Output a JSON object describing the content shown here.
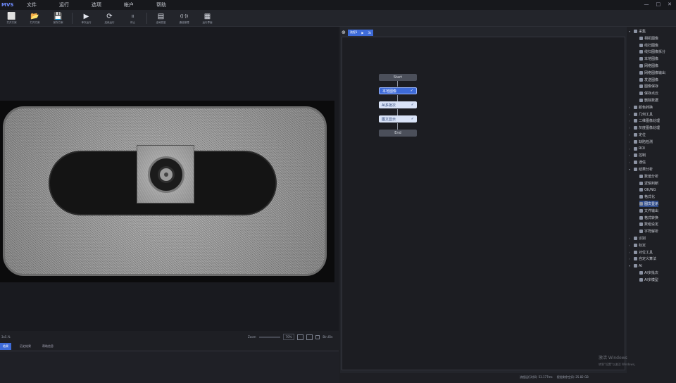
{
  "app": {
    "brand": "MVS"
  },
  "menu": [
    "文件",
    "运行",
    "选项",
    "帐户",
    "帮助"
  ],
  "window_controls": [
    "—",
    "□",
    "✕"
  ],
  "toolbar": [
    {
      "icon": "⬜",
      "label": "打开方案",
      "disabled": false
    },
    {
      "icon": "📂",
      "label": "打开方案",
      "disabled": false
    },
    {
      "icon": "💾",
      "label": "保存方案",
      "disabled": false
    },
    {
      "icon": "▶",
      "label": "单次运行",
      "disabled": false
    },
    {
      "icon": "⟳",
      "label": "连续运行",
      "disabled": false
    },
    {
      "icon": "⏸",
      "label": "停止",
      "disabled": true
    },
    {
      "icon": "▤",
      "label": "全局变量",
      "disabled": false
    },
    {
      "icon": "((·))",
      "label": "通信管理",
      "disabled": false
    },
    {
      "icon": "▦",
      "label": "运行界面",
      "disabled": false
    }
  ],
  "image_status": {
    "left": "3x5.%",
    "zoom_label": "Zoom",
    "zoom_value": "70%",
    "extra": "Bin.Bin"
  },
  "bottom_tabs": [
    {
      "label": "结果",
      "active": true
    },
    {
      "label": "历史结果",
      "active": false
    },
    {
      "label": "帮助信息",
      "active": false
    }
  ],
  "flow": {
    "tab_label": "流程1",
    "tab_play": "▶",
    "tab_count": "3s",
    "nodes": [
      {
        "label": "Start",
        "kind": "start"
      },
      {
        "label": "本地图像",
        "kind": "tool",
        "selected": true,
        "check": "✓"
      },
      {
        "label": "AI多批次",
        "kind": "tool",
        "selected": false,
        "check": "✓"
      },
      {
        "label": "图文显示",
        "kind": "tool",
        "selected": false,
        "check": "✓"
      },
      {
        "label": "End",
        "kind": "end"
      }
    ],
    "status_time": "流程运行时间: 53.177ms",
    "status_mem": "视觉剩余空间: 25.82 GB"
  },
  "tree": [
    {
      "label": "采集",
      "level": 0,
      "caret": "▾"
    },
    {
      "label": "相机图像",
      "level": 1
    },
    {
      "label": "线扫图像",
      "level": 1
    },
    {
      "label": "线扫图像拆分",
      "level": 1
    },
    {
      "label": "本地图像",
      "level": 1
    },
    {
      "label": "网络图像",
      "level": 1
    },
    {
      "label": "网络图像输出",
      "level": 1
    },
    {
      "label": "发送图像",
      "level": 1
    },
    {
      "label": "图像保存",
      "level": 1
    },
    {
      "label": "保存点云",
      "level": 1
    },
    {
      "label": "删除数据",
      "level": 1
    },
    {
      "label": "颜色转换",
      "level": 0,
      "caret": "›"
    },
    {
      "label": "几何工具",
      "level": 0,
      "caret": "›"
    },
    {
      "label": "二维图像处理",
      "level": 0,
      "caret": "›"
    },
    {
      "label": "灰度图像处理",
      "level": 0,
      "caret": "›"
    },
    {
      "label": "定位",
      "level": 0,
      "caret": "›"
    },
    {
      "label": "缺陷检测",
      "level": 0,
      "caret": "›"
    },
    {
      "label": "ROI",
      "level": 0,
      "caret": "›"
    },
    {
      "label": "控制",
      "level": 0,
      "caret": "›"
    },
    {
      "label": "通信",
      "level": 0,
      "caret": "›"
    },
    {
      "label": "结果分析",
      "level": 0,
      "caret": "▾"
    },
    {
      "label": "数值分析",
      "level": 1
    },
    {
      "label": "逻辑判断",
      "level": 1
    },
    {
      "label": "OK/NG",
      "level": 1
    },
    {
      "label": "格式化",
      "level": 1
    },
    {
      "label": "图文显示",
      "level": 1,
      "selected": true
    },
    {
      "label": "文件输出",
      "level": 1
    },
    {
      "label": "格式转换",
      "level": 1
    },
    {
      "label": "数组设定",
      "level": 1
    },
    {
      "label": "字符解析",
      "level": 1
    },
    {
      "label": "识别",
      "level": 0,
      "caret": "›"
    },
    {
      "label": "标定",
      "level": 0,
      "caret": "›"
    },
    {
      "label": "对位工具",
      "level": 0,
      "caret": "›"
    },
    {
      "label": "自定义算法",
      "level": 0,
      "caret": "›"
    },
    {
      "label": "AI",
      "level": 0,
      "caret": "▾"
    },
    {
      "label": "AI多批次",
      "level": 1
    },
    {
      "label": "AI多模型",
      "level": 1
    }
  ],
  "watermark": {
    "title": "激活 Windows",
    "subtitle": "转到\"设置\"以激活 Windows。"
  }
}
